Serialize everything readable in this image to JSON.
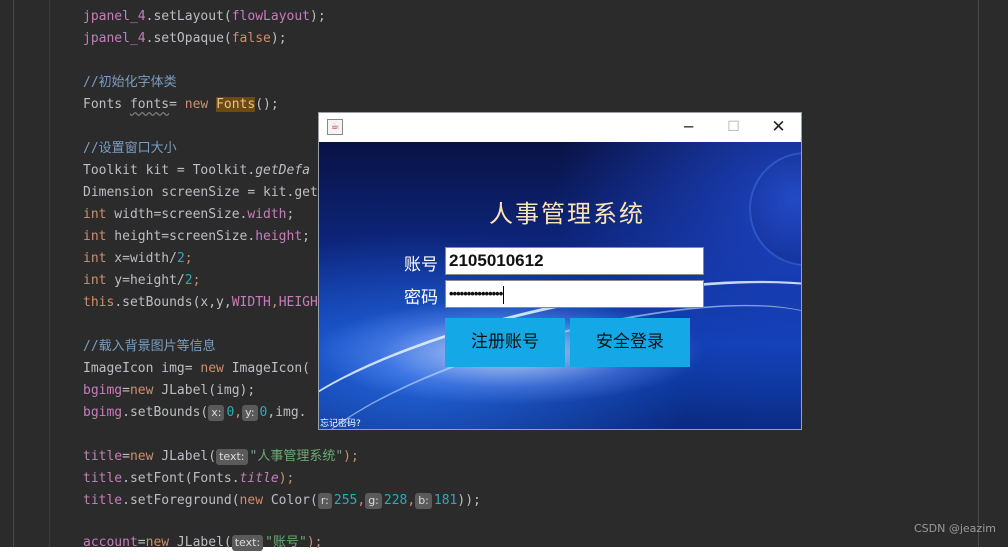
{
  "editor": {
    "lines": {
      "l1": {
        "obj": "jpanel_4",
        "m": "setLayout",
        "arg": "flowLayout"
      },
      "l2": {
        "obj": "jpanel_4",
        "m": "setOpaque",
        "arg": "false"
      },
      "l3": {
        "text": "//初始化字体类"
      },
      "l4": {
        "a": "Fonts ",
        "b": "fonts",
        "c": "= ",
        "kw": "new",
        "d": " ",
        "e": "Fonts",
        "f": "();"
      },
      "l5": {
        "text": "//设置窗口大小"
      },
      "l6": {
        "a": "Toolkit kit = Toolkit.",
        "b": "getDefa"
      },
      "l7": {
        "a": "Dimension screenSize = kit.get"
      },
      "l8": {
        "kw": "int",
        "a": " width=screenSize.",
        "b": "width",
        ";": ";"
      },
      "l9": {
        "kw": "int",
        "a": " height=screenSize.",
        "b": "height",
        "c": ";"
      },
      "l10": {
        "kw": "int",
        "a": " x=width/",
        "num": "2",
        "c": ";"
      },
      "l11": {
        "kw": "int",
        "a": " y=height/",
        "num": "2",
        "c": ";"
      },
      "l12": {
        "kw": "this",
        "a": ".setBounds(x,y,",
        "b": "WIDTH",
        "c": ",",
        "d": "HEIGH"
      },
      "l13": {
        "text": "//载入背景图片等信息"
      },
      "l14": {
        "a": "ImageIcon img= ",
        "kw": "new",
        "b": " ImageIcon("
      },
      "l15": {
        "a": "bgimg",
        "b": "=",
        "kw": "new",
        "c": " JLabel(img);"
      },
      "l16": {
        "a": "bgimg",
        ".": ".",
        "m": "setBounds(",
        "h1": "x:",
        "n1": "0",
        "c1": ",",
        "h2": "y:",
        "n2": "0",
        "rest": ",img."
      },
      "l17": {
        "a": "title",
        "b": "=",
        "kw": "new",
        "c": " JLabel(",
        "h": "text:",
        "s": "\"人事管理系统\"",
        "e": ");"
      },
      "l18": {
        "a": "title",
        ".": ".",
        "m": "setFont(Fonts.",
        "f": "title",
        "e": ");"
      },
      "l19": {
        "a": "title",
        ".": ".",
        "m": "setForeground(",
        "kw": "new",
        "c": " Color(",
        "h1": "r:",
        "n1": "255",
        "c1": ",",
        "h2": "g:",
        "n2": "228",
        "c2": ",",
        "h3": "b:",
        "n3": "181",
        "e": "));"
      },
      "l20": {
        "a": "account",
        "b": "=",
        "kw": "new",
        "c": " JLabel(",
        "h": "text:",
        "s": "\"账号\"",
        "e": ");"
      }
    },
    "watermark": "CSDN @jeazim"
  },
  "dialog": {
    "title_icon": "java-cup-icon",
    "minimize": "─",
    "maximize": "☐",
    "close": "✕",
    "app_title": "人事管理系统",
    "account_label": "账号",
    "account_value": "2105010612",
    "password_label": "密码",
    "password_value": "•••••••••••••••",
    "register_button": "注册账号",
    "login_button": "安全登录",
    "forgot_link": "忘记密码?"
  },
  "colors": {
    "title_color": "#ffe4b5",
    "button_color": "#14a8e6"
  }
}
